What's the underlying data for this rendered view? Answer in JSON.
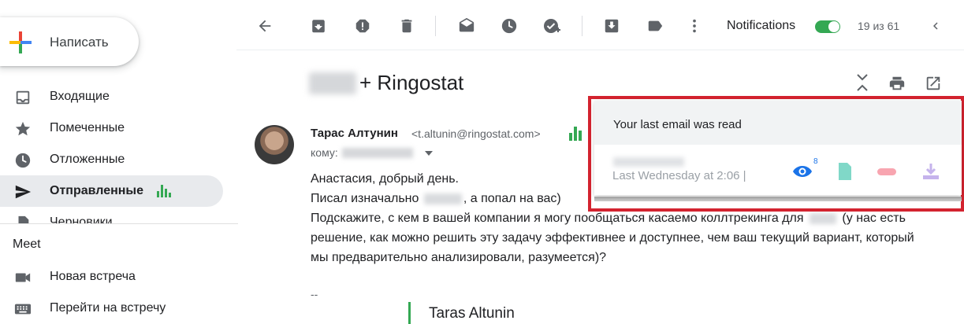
{
  "sidebar": {
    "compose_label": "Написать",
    "items": [
      {
        "label": "Входящие",
        "icon": "inbox-icon"
      },
      {
        "label": "Помеченные",
        "icon": "star-icon"
      },
      {
        "label": "Отложенные",
        "icon": "clock-icon"
      },
      {
        "label": "Отправленные",
        "icon": "send-icon",
        "active": true
      },
      {
        "label": "Черновики",
        "icon": "draft-icon"
      }
    ],
    "meet": {
      "title": "Meet",
      "items": [
        {
          "label": "Новая встреча",
          "icon": "video-icon"
        },
        {
          "label": "Перейти на встречу",
          "icon": "keyboard-icon"
        }
      ]
    }
  },
  "toolbar": {
    "notifications_label": "Notifications",
    "notifications_on": true,
    "counter": "19 из 61"
  },
  "message": {
    "subject": "+ Ringostat",
    "sender_name": "Тарас Алтунин",
    "sender_email": "<t.altunin@ringostat.com>",
    "to_label": "кому:",
    "body": {
      "line1": "Анастасия, добрый день.",
      "line2a": "Писал изначально",
      "line2b": ", а попал на вас)",
      "line3a": "Подскажите, с кем в вашей компании я могу пообщаться касаемо коллтрекинга для",
      "line3b": "(у нас есть",
      "line4": "решение, как можно решить эту задачу эффективнее и доступнее, чем ваш текущий вариант, который",
      "line5": "мы предварительно анализировали, разумеется)?"
    },
    "signature_dash": "--",
    "signature_name": "Taras Altunin"
  },
  "tracking_popup": {
    "header": "Your last email was read",
    "when": "Last Wednesday at 2:06 |",
    "views_count": "8"
  },
  "colors": {
    "accent_green": "#34a853",
    "highlight_red": "#d3232f",
    "eye_blue": "#1a73e8"
  }
}
